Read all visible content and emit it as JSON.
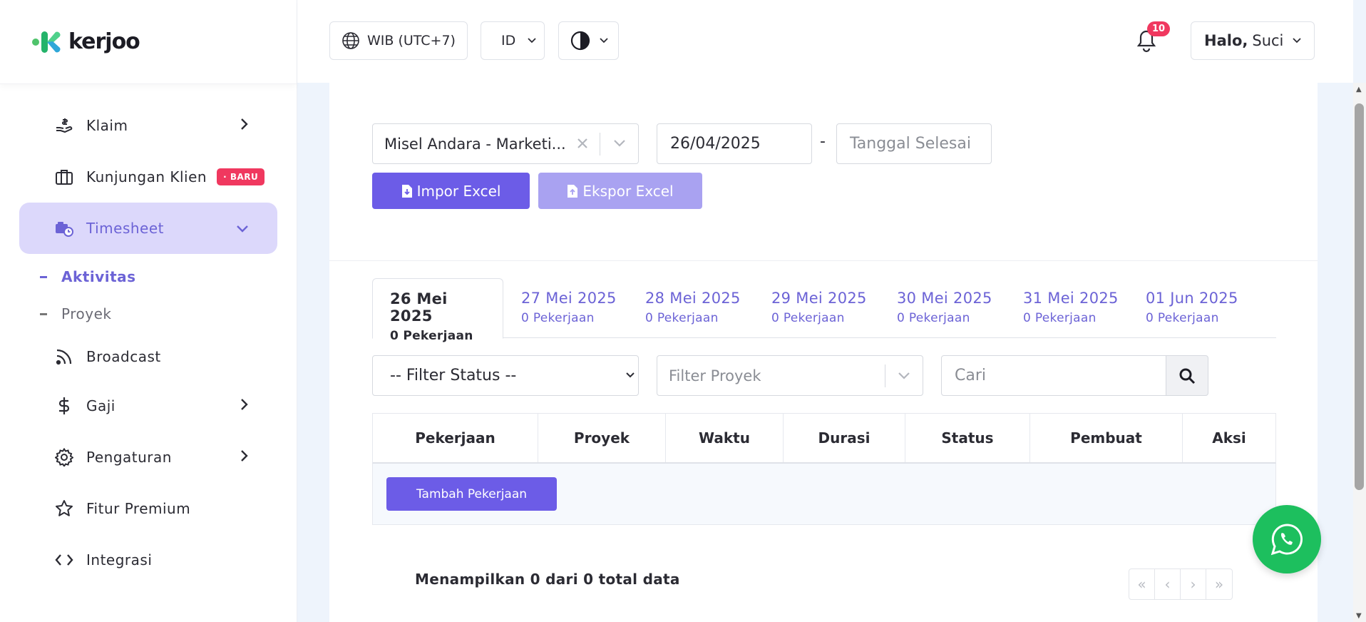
{
  "brand": {
    "name": "kerjoo"
  },
  "sidebar": {
    "items": [
      {
        "label": "Klaim",
        "icon": "hand-coin-icon",
        "has_chevron": true
      },
      {
        "label": "Kunjungan Klien",
        "icon": "briefcase-icon",
        "badge": "· BARU"
      },
      {
        "label": "Timesheet",
        "icon": "truck-clock-icon",
        "active": true,
        "expanded": true
      },
      {
        "label": "Broadcast",
        "icon": "rss-icon"
      },
      {
        "label": "Gaji",
        "icon": "dollar-icon",
        "has_chevron": true
      },
      {
        "label": "Pengaturan",
        "icon": "gear-icon",
        "has_chevron": true
      },
      {
        "label": "Fitur Premium",
        "icon": "star-icon"
      },
      {
        "label": "Integrasi",
        "icon": "code-icon"
      }
    ],
    "sub_items": [
      {
        "label": "Aktivitas",
        "active": true
      },
      {
        "label": "Proyek"
      }
    ]
  },
  "topbar": {
    "timezone": "WIB (UTC+7)",
    "language": "ID",
    "notification_count": "10",
    "greeting_bold": "Halo,",
    "user_name": "Suci"
  },
  "filters": {
    "employee_value": "Misel Andara - Marketi...",
    "start_date": "26/04/2025",
    "date_separator": "-",
    "end_date_placeholder": "Tanggal Selesai",
    "import_label": "Impor Excel",
    "export_label": "Ekspor Excel"
  },
  "tabs": [
    {
      "date": "26 Mei 2025",
      "count": "0 Pekerjaan",
      "active": true
    },
    {
      "date": "27 Mei 2025",
      "count": "0 Pekerjaan"
    },
    {
      "date": "28 Mei 2025",
      "count": "0 Pekerjaan"
    },
    {
      "date": "29 Mei 2025",
      "count": "0 Pekerjaan"
    },
    {
      "date": "30 Mei 2025",
      "count": "0 Pekerjaan"
    },
    {
      "date": "31 Mei 2025",
      "count": "0 Pekerjaan"
    },
    {
      "date": "01 Jun 2025",
      "count": "0 Pekerjaan"
    }
  ],
  "list_filters": {
    "status_value": "-- Filter Status --",
    "project_placeholder": "Filter Proyek",
    "search_placeholder": "Cari"
  },
  "table": {
    "columns": [
      "Pekerjaan",
      "Proyek",
      "Waktu",
      "Durasi",
      "Status",
      "Pembuat",
      "Aksi"
    ],
    "add_label": "Tambah Pekerjaan"
  },
  "footer": {
    "summary": "Menampilkan 0 dari 0 total data",
    "pager": [
      "«",
      "‹",
      "›",
      "»"
    ]
  },
  "colors": {
    "accent": "#6c5ce7",
    "accent_light": "#dcd8fb",
    "badge": "#f0385f",
    "whatsapp": "#1dbf5e"
  }
}
